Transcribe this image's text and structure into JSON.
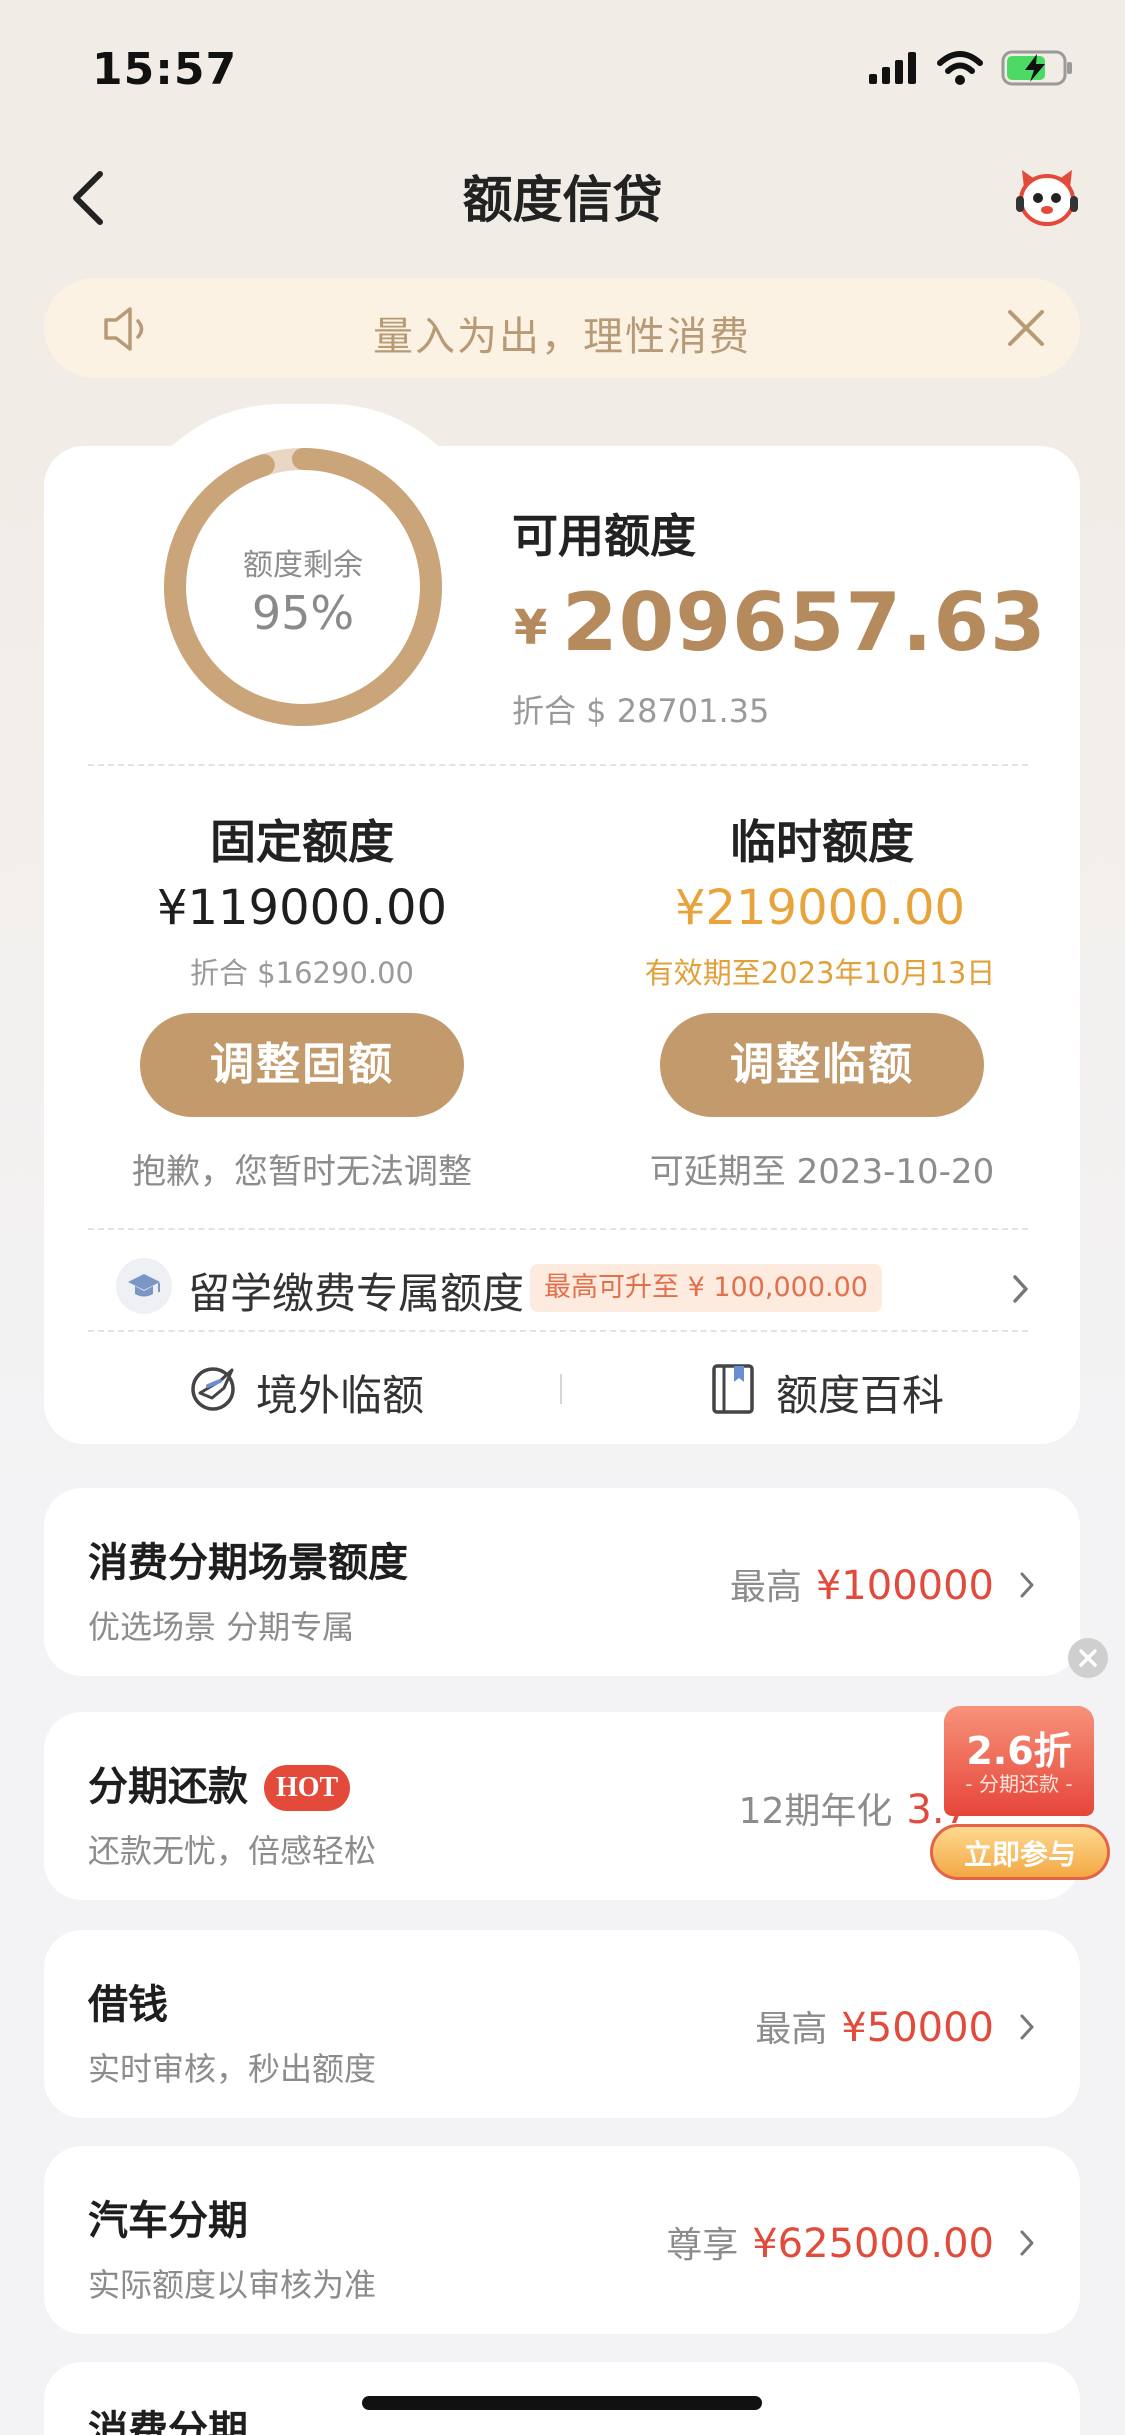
{
  "status_bar": {
    "time": "15:57"
  },
  "nav": {
    "title": "额度信贷"
  },
  "notice": {
    "text": "量入为出，理性消费"
  },
  "ring": {
    "label": "额度剩余",
    "value": "95%",
    "fraction": 0.95
  },
  "available": {
    "title": "可用额度",
    "currency": "¥",
    "amount": "209657.63",
    "converted": "折合 $ 28701.35"
  },
  "fixed": {
    "title": "固定额度",
    "amount": "¥119000.00",
    "converted": "折合 $16290.00",
    "button": "调整固额",
    "note": "抱歉，您暂时无法调整"
  },
  "temporary": {
    "title": "临时额度",
    "amount": "¥219000.00",
    "validity": "有效期至2023年10月13日",
    "button": "调整临额",
    "note": "可延期至 2023-10-20"
  },
  "education": {
    "label": "留学缴费专属额度",
    "badge": "最高可升至 ¥ 100,000.00"
  },
  "links": {
    "overseas": "境外临额",
    "wiki": "额度百科"
  },
  "rows": [
    {
      "title": "消费分期场景额度",
      "subtitle": "优选场景 分期专属",
      "prefix": "最高",
      "amount": "¥100000"
    },
    {
      "title": "分期还款",
      "hot": "HOT",
      "subtitle": "还款无忧，倍感轻松",
      "prefix": "12期年化",
      "amount": "3.7"
    },
    {
      "title": "借钱",
      "subtitle": "实时审核，秒出额度",
      "prefix": "最高",
      "amount": "¥50000"
    },
    {
      "title": "汽车分期",
      "subtitle": "实际额度以审核为准",
      "prefix": "尊享",
      "amount": "¥625000.00"
    },
    {
      "title": "消费分期"
    }
  ],
  "promo": {
    "discount": "2.6折",
    "caption": "- 分期还款 -",
    "button": "立即参与"
  },
  "colors": {
    "accent": "#c39a6b",
    "gold_text": "#b58b5d",
    "orange": "#e8a43a",
    "red": "#e24b3b"
  }
}
